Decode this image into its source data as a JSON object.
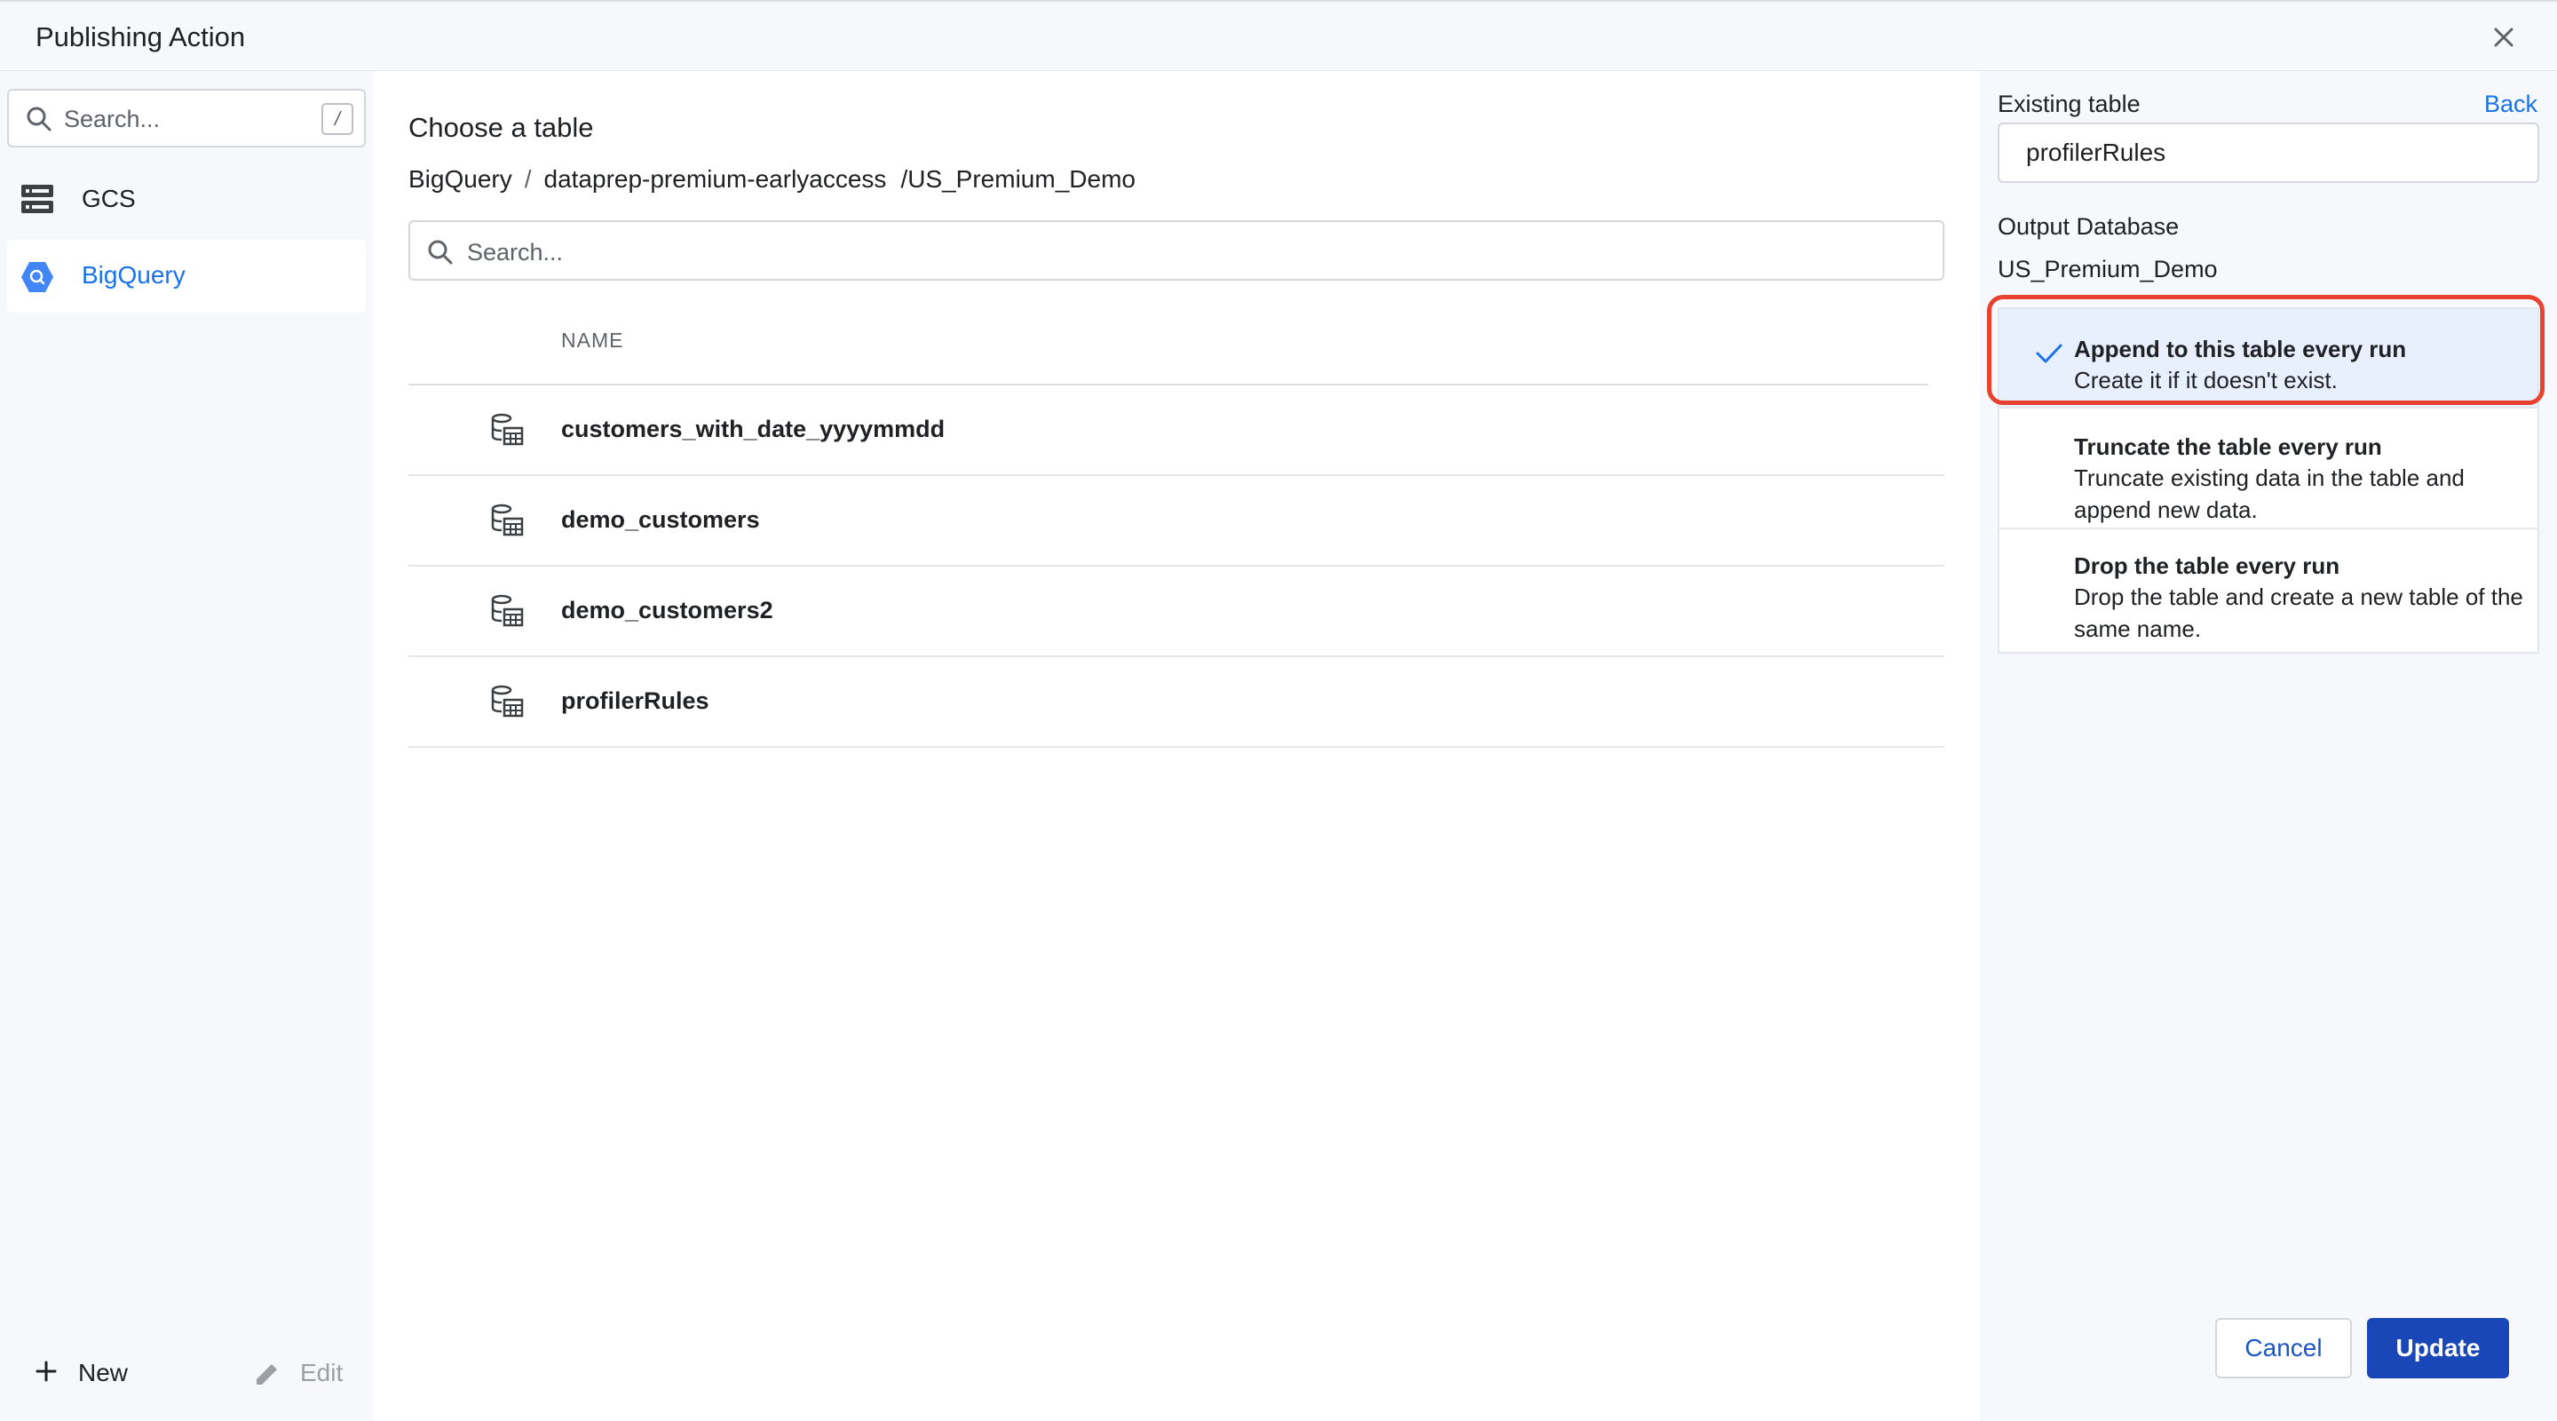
{
  "header": {
    "title": "Publishing Action"
  },
  "sidebar": {
    "search_placeholder": "Search...",
    "search_shortcut": "/",
    "items": [
      {
        "label": "GCS",
        "icon": "storage-icon",
        "selected": false
      },
      {
        "label": "BigQuery",
        "icon": "bigquery-icon",
        "selected": true
      }
    ],
    "footer": {
      "new_label": "New",
      "edit_label": "Edit"
    }
  },
  "main": {
    "title": "Choose a table",
    "breadcrumb": [
      "BigQuery",
      "dataprep-premium-earlyaccess",
      "/US_Premium_Demo"
    ],
    "search_placeholder": "Search...",
    "column_header": "NAME",
    "tables": [
      "customers_with_date_yyyymmdd",
      "demo_customers",
      "demo_customers2",
      "profilerRules"
    ]
  },
  "right_panel": {
    "existing_label": "Existing table",
    "back_label": "Back",
    "existing_value": "profilerRules",
    "output_db_label": "Output Database",
    "output_db_value": "US_Premium_Demo",
    "options": [
      {
        "title": "Append to this table every run",
        "desc": "Create it if it doesn't exist.",
        "selected": true
      },
      {
        "title": "Truncate the table every run",
        "desc": "Truncate existing data in the table and append new data.",
        "selected": false
      },
      {
        "title": "Drop the table every run",
        "desc": "Drop the table and create a new table of the same name.",
        "selected": false
      }
    ],
    "cancel_label": "Cancel",
    "update_label": "Update"
  },
  "colors": {
    "accent": "#1a73e8",
    "primary_button": "#1a47b8",
    "highlight_outline": "#e8412f",
    "selected_option_bg": "#e8f0fe",
    "panel_bg": "#f6f8fb"
  }
}
